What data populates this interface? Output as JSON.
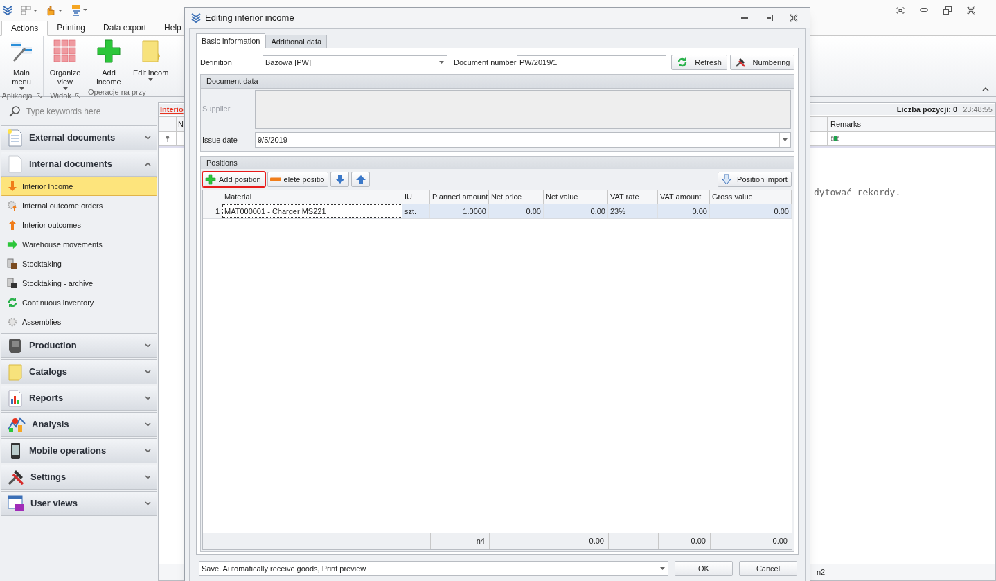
{
  "ribbon": {
    "tabs": [
      {
        "label": "Actions",
        "selected": true
      },
      {
        "label": "Printing",
        "selected": false
      },
      {
        "label": "Data export",
        "selected": false
      },
      {
        "label": "Help",
        "selected": false
      }
    ],
    "groups": [
      {
        "label": "Aplikacja",
        "buttons": [
          {
            "label": "Main menu",
            "dropdown": true
          }
        ]
      },
      {
        "label": "Widok",
        "buttons": [
          {
            "label": "Organize view",
            "dropdown": true
          }
        ]
      },
      {
        "label": "Operacje na przy",
        "buttons": [
          {
            "label": "Add income",
            "dropdown": false
          },
          {
            "label": "Edit incom",
            "dropdown": true
          }
        ]
      }
    ]
  },
  "sidebar": {
    "search": {
      "placeholder": "Type keywords here"
    },
    "groups": [
      {
        "label": "External documents",
        "expanded": false
      },
      {
        "label": "Internal documents",
        "expanded": true,
        "items": [
          {
            "label": "Interior Income",
            "selected": true
          },
          {
            "label": "Internal outcome orders",
            "selected": false
          },
          {
            "label": "Interior outcomes",
            "selected": false
          },
          {
            "label": "Warehouse movements",
            "selected": false
          },
          {
            "label": "Stocktaking",
            "selected": false
          },
          {
            "label": "Stocktaking - archive",
            "selected": false
          },
          {
            "label": "Continuous inventory",
            "selected": false
          },
          {
            "label": "Assemblies",
            "selected": false
          }
        ]
      },
      {
        "label": "Production",
        "expanded": false
      },
      {
        "label": "Catalogs",
        "expanded": false
      },
      {
        "label": "Reports",
        "expanded": false
      },
      {
        "label": "Analysis",
        "expanded": false
      },
      {
        "label": "Mobile operations",
        "expanded": false
      },
      {
        "label": "Settings",
        "expanded": false
      },
      {
        "label": "User views",
        "expanded": false
      }
    ]
  },
  "main": {
    "title": "Interio",
    "count": "Liczba pozycji: 0",
    "time": "23:48:55",
    "columns": [
      "N",
      "Remarks"
    ],
    "message": "dytować rekordy.",
    "footer": "n2"
  },
  "dialog": {
    "title": "Editing interior income",
    "tabs": [
      {
        "label": "Basic information",
        "selected": true
      },
      {
        "label": "Additional data",
        "selected": false
      }
    ],
    "definition": {
      "label": "Definition",
      "value": "Bazowa [PW]"
    },
    "document_number": {
      "label": "Document number",
      "value": "PW/2019/1"
    },
    "buttons": [
      {
        "label": "Refresh"
      },
      {
        "label": "Numbering"
      }
    ],
    "document_data": {
      "title": "Document data",
      "supplier_label": "Supplier",
      "issue_date": {
        "label": "Issue date",
        "value": "9/5/2019"
      }
    },
    "positions": {
      "title": "Positions",
      "toolbar": [
        {
          "kind": "add",
          "label": "Add position",
          "highlighted": true
        },
        {
          "kind": "delete",
          "label": "elete positio",
          "highlighted": false
        },
        {
          "kind": "down",
          "highlighted": false
        },
        {
          "kind": "up",
          "highlighted": false
        }
      ],
      "import_button": "Position import",
      "columns": [
        {
          "label": "Material",
          "kind": "text"
        },
        {
          "label": "IU",
          "kind": "text"
        },
        {
          "label": "Planned amount",
          "kind": "number"
        },
        {
          "label": "Net price",
          "kind": "number"
        },
        {
          "label": "Net value",
          "kind": "number"
        },
        {
          "label": "VAT rate",
          "kind": "text"
        },
        {
          "label": "VAT amount",
          "kind": "number"
        },
        {
          "label": "Gross value",
          "kind": "number"
        }
      ],
      "rows": [
        {
          "number": "1",
          "selected": true,
          "cells": [
            "MAT000001 - Charger MS221",
            "szt.",
            "1.0000",
            "0.00",
            "0.00",
            "23%",
            "0.00",
            "0.00"
          ]
        }
      ],
      "summary": {
        "planned_amount": "n4",
        "net_value": "0.00",
        "vat_amount": "0.00",
        "gross_value": "0.00"
      }
    },
    "action": {
      "value": "Save, Automatically receive goods, Print preview"
    },
    "ok": "OK",
    "cancel": "Cancel"
  }
}
